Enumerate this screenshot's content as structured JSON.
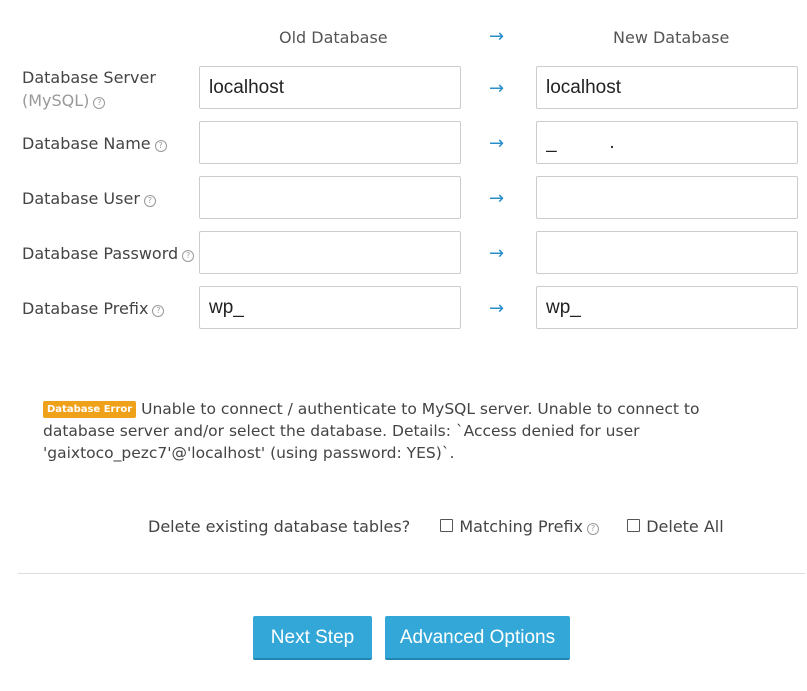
{
  "headers": {
    "old": "Old Database",
    "arrow": "→",
    "new": "New Database"
  },
  "help_glyph": "?",
  "rows": [
    {
      "label": "Database Server",
      "sublabel": "(MySQL)",
      "old_value": "localhost",
      "new_value": "localhost",
      "arrow": "→"
    },
    {
      "label": "Database Name",
      "old_value": "",
      "new_value": "_          .",
      "arrow": "→"
    },
    {
      "label": "Database User",
      "old_value": "",
      "new_value": "",
      "arrow": "→"
    },
    {
      "label": "Database Password",
      "old_value": "",
      "new_value": "",
      "arrow": "→"
    },
    {
      "label": "Database Prefix",
      "old_value": "wp_",
      "new_value": "wp_",
      "arrow": "→"
    }
  ],
  "error": {
    "badge": "Database Error",
    "message": "Unable to connect / authenticate to MySQL server. Unable to connect to database server and/or select the database. Details: `Access denied for user 'gaixtoco_pezc7'@'localhost' (using password: YES)`."
  },
  "delete_tables": {
    "question": "Delete existing database tables?",
    "option_matching_prefix": "Matching Prefix",
    "option_delete_all": "Delete All"
  },
  "buttons": {
    "next_step": "Next Step",
    "advanced_options": "Advanced Options"
  },
  "colors": {
    "accent": "#33a7d8",
    "arrow": "#2a8fc9",
    "badge": "#f0a11a"
  }
}
